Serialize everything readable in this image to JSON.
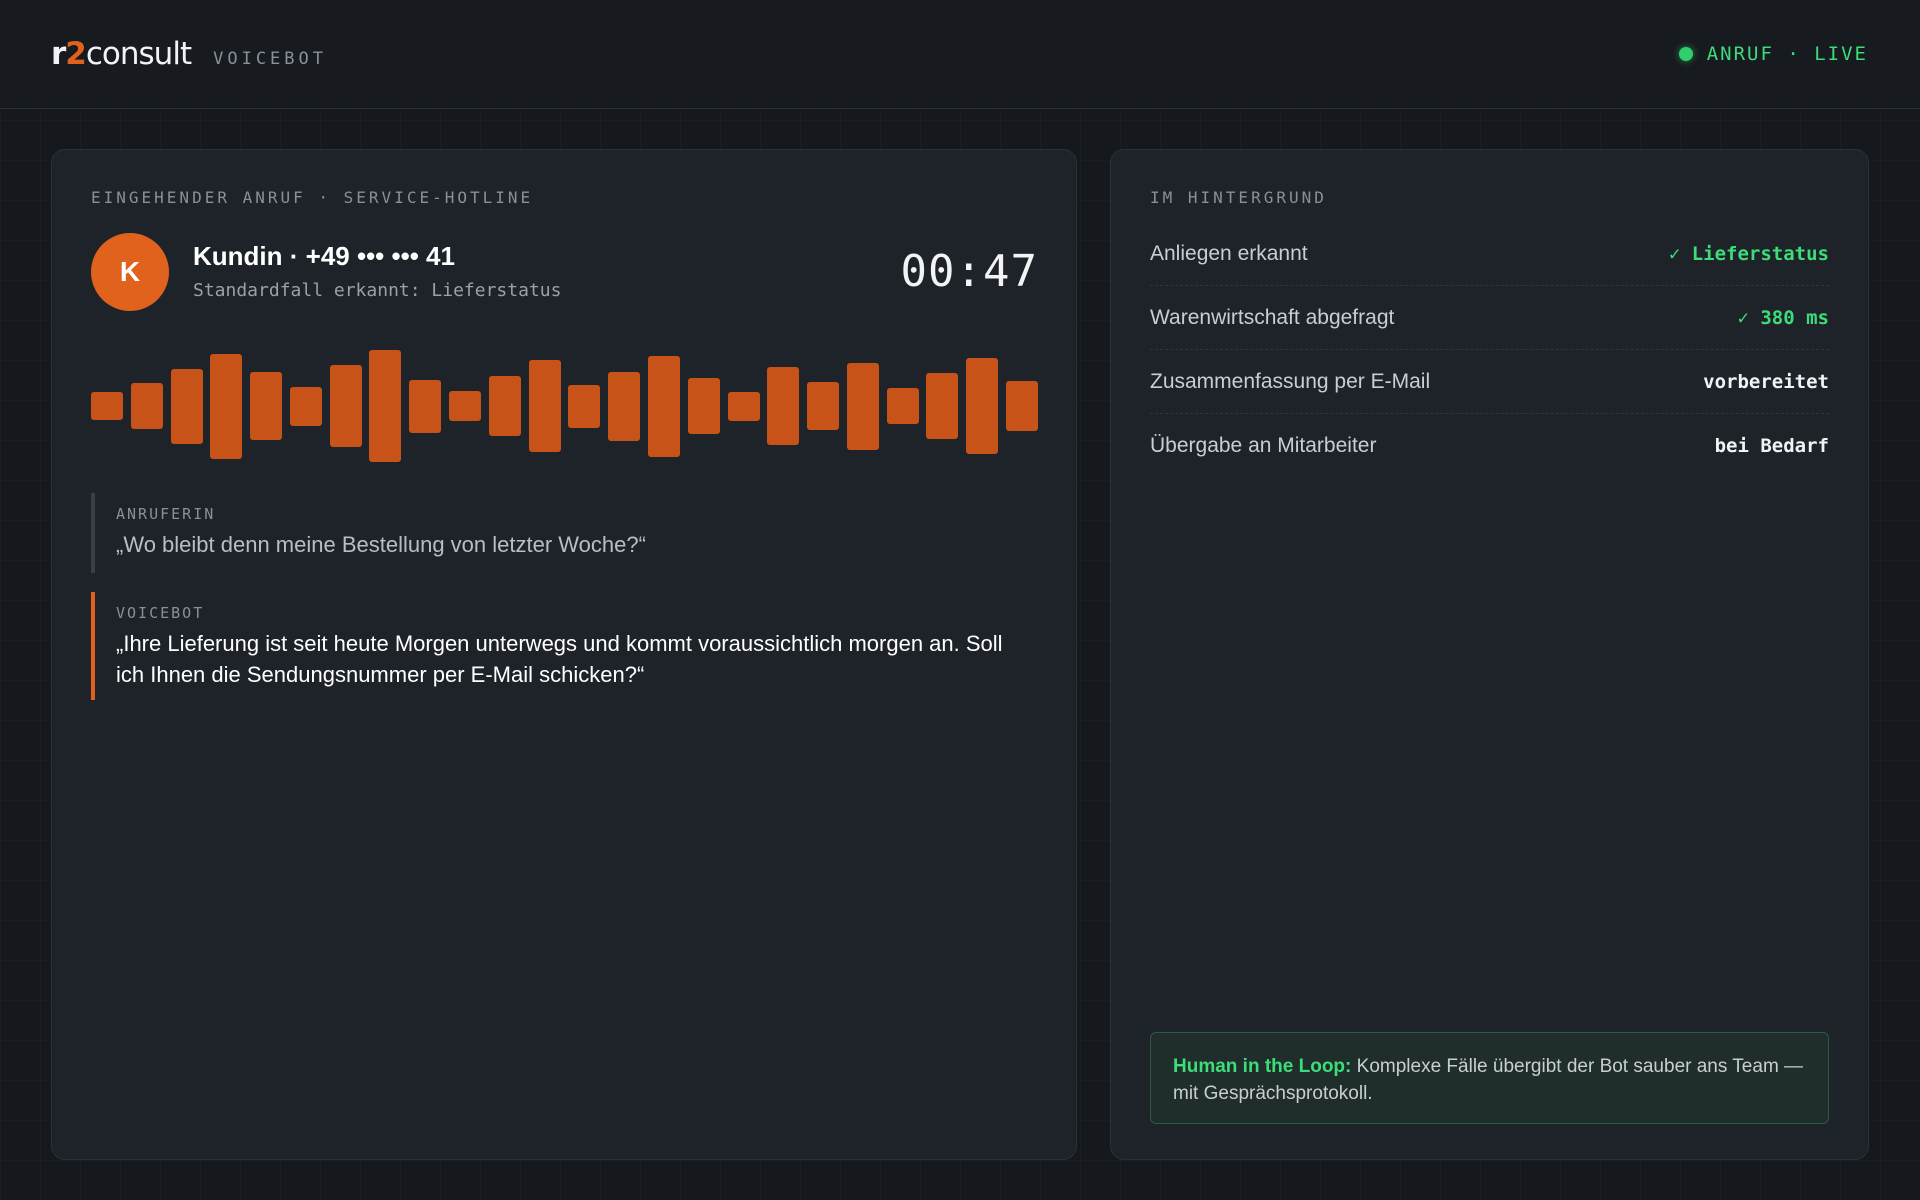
{
  "header": {
    "logo_r": "r",
    "logo_two": "2",
    "logo_rest": "consult",
    "product": "VOICEBOT",
    "status": "ANRUF · LIVE",
    "status_color": "#3ddc7a"
  },
  "call": {
    "eyebrow": "EINGEHENDER ANRUF · SERVICE-HOTLINE",
    "avatar_initial": "K",
    "caller": "Kundin · +49 ••• ••• 41",
    "subtitle": "Standardfall erkannt: Lieferstatus",
    "timer": "00:47",
    "accent": "#e0621c",
    "waveform_levels": [
      0.25,
      0.41,
      0.67,
      0.94,
      0.61,
      0.35,
      0.73,
      1.0,
      0.47,
      0.27,
      0.54,
      0.82,
      0.38,
      0.62,
      0.9,
      0.5,
      0.26,
      0.7,
      0.43,
      0.78,
      0.32,
      0.59,
      0.86,
      0.45
    ]
  },
  "transcript": [
    {
      "speaker": "ANRUFERIN",
      "text": "„Wo bleibt denn meine Bestellung von letzter Woche?“"
    },
    {
      "speaker": "VOICEBOT",
      "text": "„Ihre Lieferung ist seit heute Morgen unterwegs und kommt voraussichtlich morgen an. Soll ich Ihnen die Sendungsnummer per E-Mail schicken?“"
    }
  ],
  "background": {
    "eyebrow": "IM HINTERGRUND",
    "rows": [
      {
        "label": "Anliegen erkannt",
        "value": "✓ Lieferstatus",
        "state": "ok"
      },
      {
        "label": "Warenwirtschaft abgefragt",
        "value": "✓ 380 ms",
        "state": "ok"
      },
      {
        "label": "Zusammenfassung per E-Mail",
        "value": "vorbereitet",
        "state": "neutral"
      },
      {
        "label": "Übergabe an Mitarbeiter",
        "value": "bei Bedarf",
        "state": "neutral"
      }
    ],
    "hitl_title": "Human in the Loop:",
    "hitl_text": "Komplexe Fälle übergibt der Bot sauber ans Team — mit Gesprächsprotokoll."
  }
}
